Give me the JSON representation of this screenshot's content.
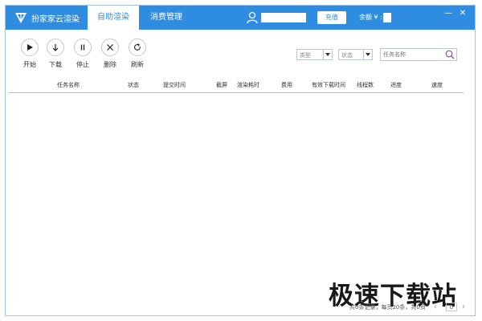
{
  "app": {
    "title": "扮家家云渲染",
    "tabs": [
      {
        "label": "自助渲染",
        "active": true
      },
      {
        "label": "消费管理",
        "active": false
      }
    ],
    "recharge_label": "充值",
    "balance_label": "余额 ¥ :"
  },
  "toolbar": {
    "start": "开始",
    "download": "下载",
    "stop": "停止",
    "delete": "删除",
    "refresh": "刷新"
  },
  "filters": {
    "type": "类型",
    "status": "状态",
    "search_placeholder": "任务名称"
  },
  "table": {
    "columns": [
      "任务名称",
      "状态",
      "提交时间",
      "截屏",
      "渲染耗时",
      "费用",
      "有效下载时间",
      "线程数",
      "进度",
      "速度"
    ],
    "rows": []
  },
  "footer": {
    "summary": "共0条记录，每页20条，共0页",
    "page": "0"
  },
  "watermark": "极速下载站",
  "colors": {
    "titlebar": "#2e8de0",
    "border": "#9cc4e8"
  }
}
